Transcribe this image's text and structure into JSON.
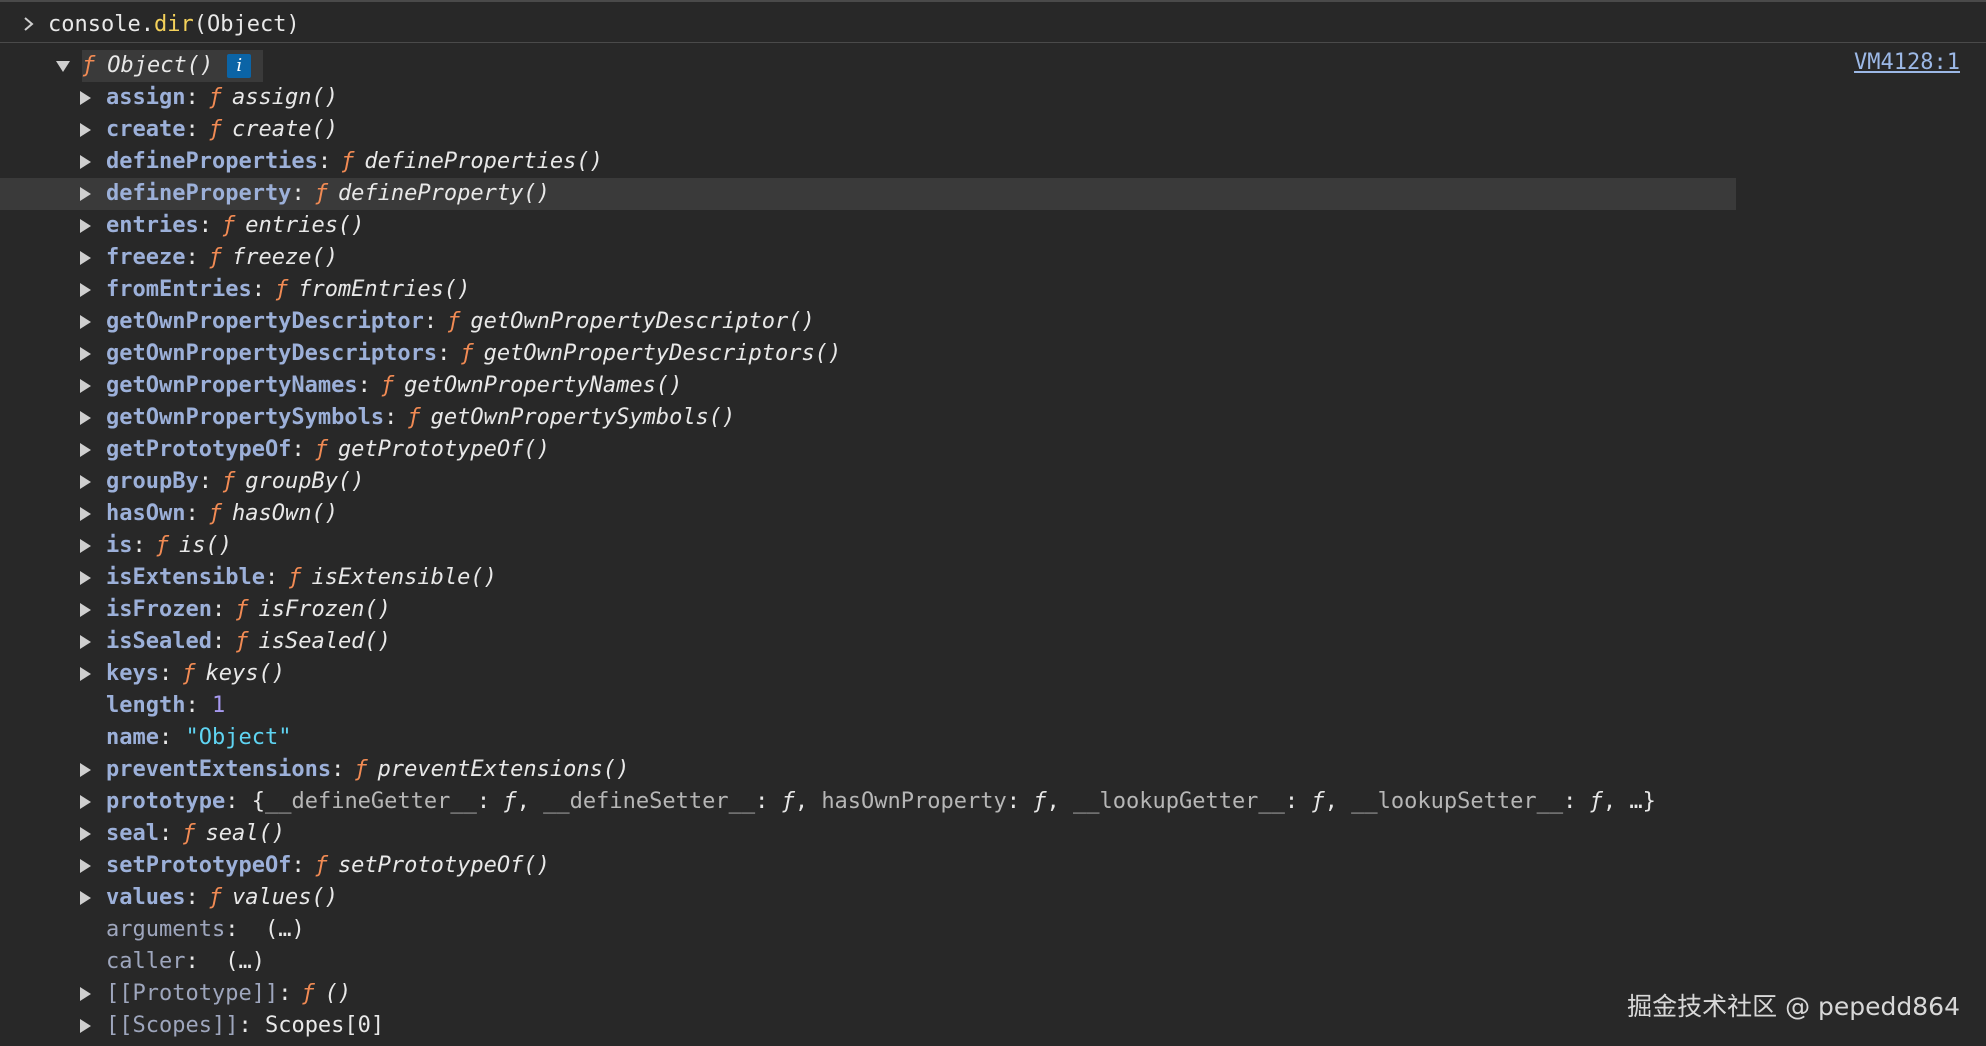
{
  "console_input": {
    "object": "console",
    "dot": ".",
    "method": "dir",
    "args": "(Object)"
  },
  "source_link": "VM4128:1",
  "root": {
    "f": "ƒ",
    "label": "Object()",
    "info": "i"
  },
  "function_symbol": "ƒ",
  "entries": [
    {
      "key": "assign",
      "fn": "assign()",
      "kind": "fn",
      "expandable": true
    },
    {
      "key": "create",
      "fn": "create()",
      "kind": "fn",
      "expandable": true
    },
    {
      "key": "defineProperties",
      "fn": "defineProperties()",
      "kind": "fn",
      "expandable": true
    },
    {
      "key": "defineProperty",
      "fn": "defineProperty()",
      "kind": "fn",
      "expandable": true,
      "highlight": true
    },
    {
      "key": "entries",
      "fn": "entries()",
      "kind": "fn",
      "expandable": true
    },
    {
      "key": "freeze",
      "fn": "freeze()",
      "kind": "fn",
      "expandable": true
    },
    {
      "key": "fromEntries",
      "fn": "fromEntries()",
      "kind": "fn",
      "expandable": true
    },
    {
      "key": "getOwnPropertyDescriptor",
      "fn": "getOwnPropertyDescriptor()",
      "kind": "fn",
      "expandable": true
    },
    {
      "key": "getOwnPropertyDescriptors",
      "fn": "getOwnPropertyDescriptors()",
      "kind": "fn",
      "expandable": true
    },
    {
      "key": "getOwnPropertyNames",
      "fn": "getOwnPropertyNames()",
      "kind": "fn",
      "expandable": true
    },
    {
      "key": "getOwnPropertySymbols",
      "fn": "getOwnPropertySymbols()",
      "kind": "fn",
      "expandable": true
    },
    {
      "key": "getPrototypeOf",
      "fn": "getPrototypeOf()",
      "kind": "fn",
      "expandable": true
    },
    {
      "key": "groupBy",
      "fn": "groupBy()",
      "kind": "fn",
      "expandable": true
    },
    {
      "key": "hasOwn",
      "fn": "hasOwn()",
      "kind": "fn",
      "expandable": true
    },
    {
      "key": "is",
      "fn": "is()",
      "kind": "fn",
      "expandable": true
    },
    {
      "key": "isExtensible",
      "fn": "isExtensible()",
      "kind": "fn",
      "expandable": true
    },
    {
      "key": "isFrozen",
      "fn": "isFrozen()",
      "kind": "fn",
      "expandable": true
    },
    {
      "key": "isSealed",
      "fn": "isSealed()",
      "kind": "fn",
      "expandable": true
    },
    {
      "key": "keys",
      "fn": "keys()",
      "kind": "fn",
      "expandable": true
    },
    {
      "key": "length",
      "value": "1",
      "kind": "num",
      "expandable": false
    },
    {
      "key": "name",
      "value": "\"Object\"",
      "kind": "str",
      "expandable": false
    },
    {
      "key": "preventExtensions",
      "fn": "preventExtensions()",
      "kind": "fn",
      "expandable": true
    },
    {
      "key": "prototype",
      "kind": "proto",
      "expandable": true,
      "proto_open": "{",
      "proto_items": [
        {
          "k": "__defineGetter__",
          "v": "ƒ"
        },
        {
          "k": "__defineSetter__",
          "v": "ƒ"
        },
        {
          "k": "hasOwnProperty",
          "v": "ƒ"
        },
        {
          "k": "__lookupGetter__",
          "v": "ƒ"
        },
        {
          "k": "__lookupSetter__",
          "v": "ƒ"
        }
      ],
      "proto_close": "…}"
    },
    {
      "key": "seal",
      "fn": "seal()",
      "kind": "fn",
      "expandable": true
    },
    {
      "key": "setPrototypeOf",
      "fn": "setPrototypeOf()",
      "kind": "fn",
      "expandable": true
    },
    {
      "key": "values",
      "fn": "values()",
      "kind": "fn",
      "expandable": true
    },
    {
      "key": "arguments",
      "value": "(…)",
      "kind": "lazy",
      "expandable": false
    },
    {
      "key": "caller",
      "value": "(…)",
      "kind": "lazy",
      "expandable": false
    },
    {
      "key": "[[Prototype]]",
      "fn": "()",
      "kind": "internal-fn",
      "expandable": true
    },
    {
      "key": "[[Scopes]]",
      "value": "Scopes[0]",
      "kind": "internal",
      "expandable": true
    }
  ],
  "watermark": "掘金技术社区 @ pepedd864"
}
